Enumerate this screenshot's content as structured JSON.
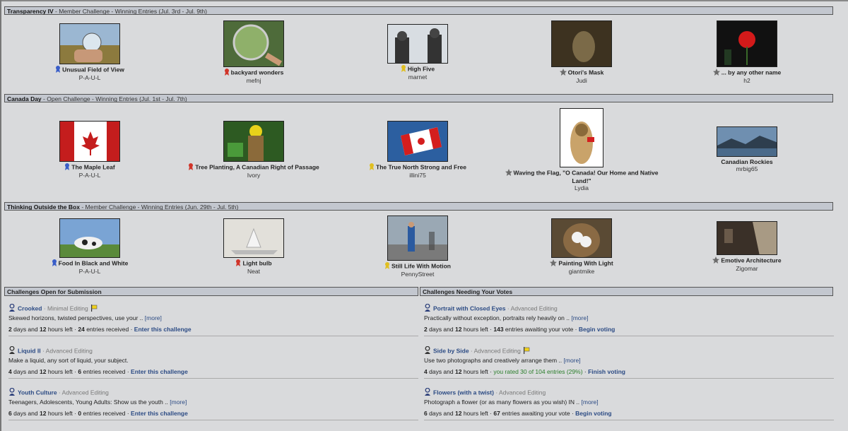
{
  "sections": [
    {
      "title": "Transparency IV",
      "subtitle": " - Member Challenge - Winning Entries (Jul. 3rd - Jul. 9th)",
      "entries": [
        {
          "title": "Unusual Field of View",
          "author": "P-A-U-L",
          "award": "blue-ribbon"
        },
        {
          "title": "backyard wonders",
          "author": "mefnj",
          "award": "red-ribbon"
        },
        {
          "title": "High Five",
          "author": "marnet",
          "award": "yellow-ribbon"
        },
        {
          "title": "Otori's Mask",
          "author": "Judi",
          "award": "star"
        },
        {
          "title": "... by any other name",
          "author": "h2",
          "award": "star"
        }
      ]
    },
    {
      "title": "Canada Day",
      "subtitle": " - Open Challenge - Winning Entries (Jul. 1st - Jul. 7th)",
      "entries": [
        {
          "title": "The Maple Leaf",
          "author": "P-A-U-L",
          "award": "blue-ribbon"
        },
        {
          "title": "Tree Planting, A Canadian Right of Passage",
          "author": "Ivory",
          "award": "red-ribbon"
        },
        {
          "title": "The True North Strong and Free",
          "author": "illini75",
          "award": "yellow-ribbon"
        },
        {
          "title": "Waving the Flag, \"O Canada! Our Home and Native Land!\"",
          "author": "Lydia",
          "award": "star"
        },
        {
          "title": "Canadian Rockies",
          "author": "mrbig65",
          "award": "none"
        }
      ]
    },
    {
      "title": "Thinking Outside the Box",
      "subtitle": " - Member Challenge - Winning Entries (Jun. 29th - Jul. 5th)",
      "entries": [
        {
          "title": "Food In Black and White",
          "author": "P-A-U-L",
          "award": "blue-ribbon"
        },
        {
          "title": "Light bulb",
          "author": "Neat",
          "award": "red-ribbon"
        },
        {
          "title": "Still Life With Motion",
          "author": "PennyStreet",
          "award": "yellow-ribbon"
        },
        {
          "title": "Painting With Light",
          "author": "giantmike",
          "award": "star"
        },
        {
          "title": "Emotive Architecture",
          "author": "Zigomar",
          "award": "star"
        }
      ]
    }
  ],
  "open_panel": {
    "title": "Challenges Open for Submission",
    "items": [
      {
        "title": "Crooked",
        "type": "Minimal Editing",
        "flag": true,
        "desc": "Skewed horizons, twisted perspectives, use your ..",
        "more": "[more]",
        "days": "2",
        "hours": "12",
        "count": "24",
        "count_label": "entries received",
        "action": "Enter this challenge"
      },
      {
        "title": "Liquid II",
        "type": "Advanced Editing",
        "flag": false,
        "desc": "Make a liquid, any sort of liquid, your subject.",
        "more": "",
        "days": "4",
        "hours": "12",
        "count": "6",
        "count_label": "entries received",
        "action": "Enter this challenge"
      },
      {
        "title": "Youth Culture",
        "type": "Advanced Editing",
        "flag": false,
        "desc": "Teenagers, Adolescents, Young Adults: Show us the youth ..",
        "more": "[more]",
        "days": "6",
        "hours": "12",
        "count": "0",
        "count_label": "entries received",
        "action": "Enter this challenge"
      }
    ]
  },
  "vote_panel": {
    "title": "Challenges Needing Your Votes",
    "items": [
      {
        "title": "Portrait with Closed Eyes",
        "type": "Advanced Editing",
        "flag": false,
        "desc": "Practically without exception, portraits rely heavily on ..",
        "more": "[more]",
        "days": "2",
        "hours": "12",
        "count": "143",
        "count_label": "entries awaiting your vote",
        "action": "Begin voting",
        "rated": ""
      },
      {
        "title": "Side by Side",
        "type": "Advanced Editing",
        "flag": true,
        "desc": "Use two photographs and creatively arrange them ..",
        "more": "[more]",
        "days": "4",
        "hours": "12",
        "count": "",
        "count_label": "",
        "action": "Finish voting",
        "rated": "you rated 30 of 104 entries (29%)"
      },
      {
        "title": "Flowers (with a twist)",
        "type": "Advanced Editing",
        "flag": false,
        "desc": "Photograph a flower (or as many flowers as you wish) IN ..",
        "more": "[more]",
        "days": "6",
        "hours": "12",
        "count": "67",
        "count_label": "entries awaiting your vote",
        "action": "Begin voting",
        "rated": ""
      }
    ]
  },
  "labels": {
    "days": "days and",
    "hours": "hours left",
    "sep": " · "
  }
}
